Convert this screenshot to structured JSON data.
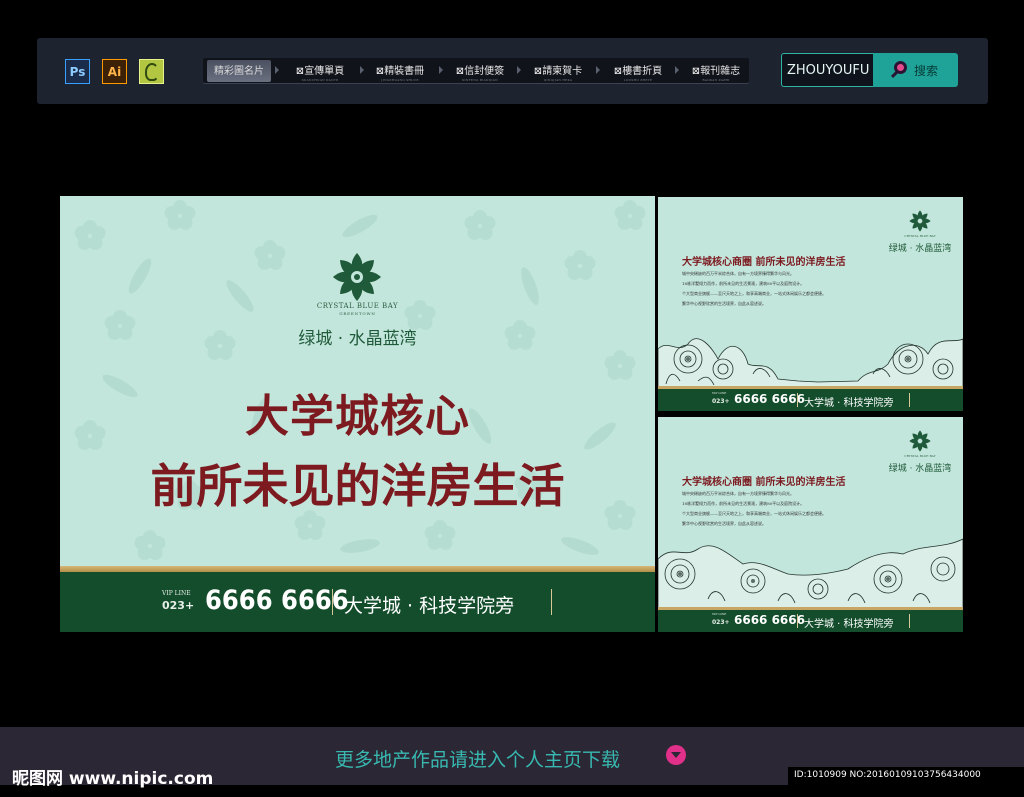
{
  "toolbar": {
    "app_icons": [
      {
        "label": "Ps",
        "icon": "photoshop-icon"
      },
      {
        "label": "Ai",
        "icon": "illustrator-icon"
      },
      {
        "label": "",
        "icon": "coreldraw-icon"
      }
    ],
    "tabs": [
      {
        "label": "精彩圖名片",
        "sub": "",
        "active": true
      },
      {
        "label": "宣傳單頁",
        "sub": "XUANCHUAN DANYE"
      },
      {
        "label": "精裝書冊",
        "sub": "JINGZHUANG SHUCE"
      },
      {
        "label": "信封便簽",
        "sub": "XINFENG BIANQIAN"
      },
      {
        "label": "請柬賀卡",
        "sub": "QINGJIAN HEKA"
      },
      {
        "label": "樓書折頁",
        "sub": "LOUSHU ZHEYE"
      },
      {
        "label": "報刊雜志",
        "sub": "BAOKAN ZAZHI"
      }
    ],
    "tab_glyph": "⊠",
    "search_value": "ZHOUYOUFU",
    "search_button": "搜索",
    "accent_color": "#1fa399"
  },
  "poster_main": {
    "brand_en": "CRYSTAL BLUE BAY",
    "brand_sub": "GREENTOWN",
    "brand_cn": "绿城 · 水晶蓝湾",
    "headline_1": "大学城核心",
    "headline_2": "前所未见的洋房生活",
    "vip_label": "VIP LINE",
    "area_code": "023+",
    "phone": "6666 6666",
    "location": "大学城 · 科技学院旁",
    "bg_color": "#c3e6dc",
    "footer_color": "#134d2c",
    "headline_color": "#7c1a20"
  },
  "poster_small": {
    "brand_en": "CRYSTAL BLUE BAY",
    "brand_cn": "绿城 · 水晶蓝湾",
    "headline": "大学城核心商圈  前所未见的洋房生活",
    "body_lines": [
      "城中央稀缺的百万平米综合体，自有一方境界臻得繁华与风光。",
      "18栋洋墅倾力而作，前所未见的生活景观，建筑80平以及庭院设计。",
      "个大型商业旗舰——至尺天地之上，和享高端商业，一站式休闲娱乐之都会便捷。",
      "繁华中心视野欣赏的生活境界，自此从容述说。"
    ],
    "vip_label": "VIP LINE",
    "area_code": "023+",
    "phone": "6666 6666",
    "location": "大学城 · 科技学院旁"
  },
  "banner": {
    "text": "更多地产作品请进入个人主页下载",
    "icon": "download-arrow-icon"
  },
  "watermark": {
    "logo_text": "昵图网 www.nipic.com",
    "id_text": "ID:1010909 NO:20160109103756434000"
  }
}
